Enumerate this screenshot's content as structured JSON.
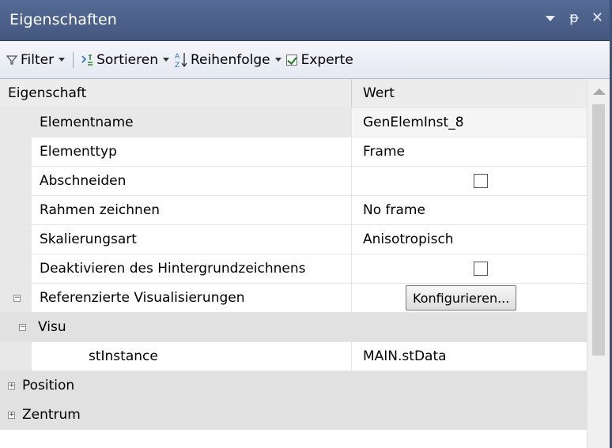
{
  "title": "Eigenschaften",
  "toolbar": {
    "filter_label": "Filter",
    "sort_label": "Sortieren",
    "order_label": "Reihenfolge",
    "expert_label": "Experte",
    "expert_checked": true
  },
  "grid": {
    "header": {
      "property": "Eigenschaft",
      "value": "Wert"
    },
    "rows": [
      {
        "name": "Elementname",
        "value": "GenElemInst_8"
      },
      {
        "name": "Elementtyp",
        "value": "Frame"
      },
      {
        "name": "Abschneiden",
        "value": "",
        "checkbox": false
      },
      {
        "name": "Rahmen zeichnen",
        "value": "No frame"
      },
      {
        "name": "Skalierungsart",
        "value": "Anisotropisch"
      },
      {
        "name": "Deaktivieren des Hintergrundzeichnens",
        "value": "",
        "checkbox": false
      },
      {
        "name": "Referenzierte Visualisierungen",
        "button": "Konfigurieren..."
      },
      {
        "name": "Visu"
      },
      {
        "name": "stInstance",
        "value": "MAIN.stData"
      },
      {
        "name": "Position"
      },
      {
        "name": "Zentrum"
      }
    ]
  },
  "icons": {
    "dropdown": "dropdown-arrow-icon",
    "pin": "pin-icon",
    "close": "close-icon",
    "filter": "filter-icon",
    "sort": "sort-icon",
    "order": "az-order-icon"
  }
}
